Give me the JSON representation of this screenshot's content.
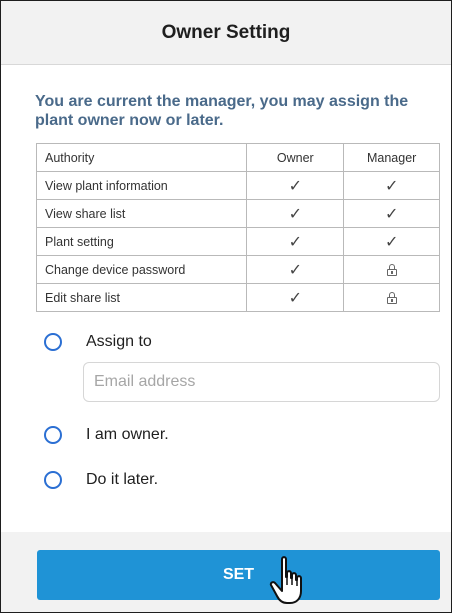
{
  "header": {
    "title": "Owner Setting"
  },
  "notice": "You are current the manager, you may assign the plant owner now or later.",
  "authority_table": {
    "headers": [
      "Authority",
      "Owner",
      "Manager"
    ],
    "rows": [
      {
        "label": "View plant information",
        "owner": "✓",
        "manager": "✓"
      },
      {
        "label": "View share list",
        "owner": "✓",
        "manager": "✓"
      },
      {
        "label": "Plant setting",
        "owner": "✓",
        "manager": "✓"
      },
      {
        "label": "Change device password",
        "owner": "✓",
        "manager": "lock-icon"
      },
      {
        "label": "Edit share list",
        "owner": "✓",
        "manager": "lock-icon"
      }
    ]
  },
  "options": {
    "assign_to": "Assign to",
    "email_placeholder": "Email address",
    "i_am_owner": "I am owner.",
    "do_it_later": "Do it later."
  },
  "footer": {
    "set_label": "SET"
  },
  "colors": {
    "accent": "#1f93d6",
    "radio": "#2b6fd3",
    "notice_text": "#4a6a8a",
    "header_bg": "#f2f2f2"
  }
}
